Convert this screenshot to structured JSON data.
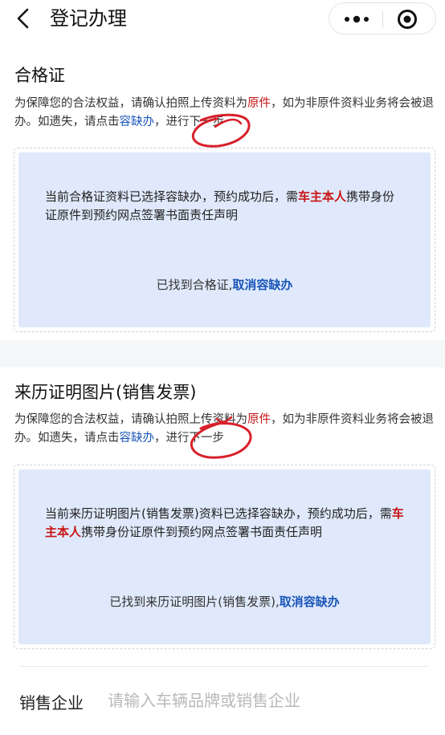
{
  "nav": {
    "title": "登记办理"
  },
  "sections": [
    {
      "title": "合格证",
      "desc_pre": "为保障您的合法权益，请确认拍照上传资料为",
      "desc_red": "原件",
      "desc_mid": "，如为非原件资料业务将会被退办。如遗失，请点击",
      "desc_link": "容缺办",
      "desc_post": "，进行下一步",
      "card_pre": "当前合格证资料已选择容缺办，预约成功后，需",
      "card_red": "车主本人",
      "card_post": "携带身份证原件到预约网点签署书面责任声明",
      "found_text": "已找到合格证,",
      "cancel_link": "取消容缺办"
    },
    {
      "title": "来历证明图片(销售发票)",
      "desc_pre": "为保障您的合法权益，请确认拍照上传资料为",
      "desc_red": "原件",
      "desc_mid": "，如为非原件资料业务将会被退办。如遗失，请点击",
      "desc_link": "容缺办",
      "desc_post": "，进行下一步",
      "card_pre": "当前来历证明图片(销售发票)资料已选择容缺办，预约成功后，需",
      "card_red": "车主本人",
      "card_post": "携带身份证原件到预约网点签署书面责任声明",
      "found_text": "已找到来历证明图片(销售发票),",
      "cancel_link": "取消容缺办"
    }
  ],
  "sales_field": {
    "label": "销售企业",
    "placeholder": "请输入车辆品牌或销售企业",
    "value": ""
  },
  "colors": {
    "red": "#c81414",
    "blue": "#1a55b8",
    "card_bg": "#dfe9fb",
    "annotation": "#d8202a"
  },
  "icons": {
    "back": "chevron-left-icon",
    "more": "more-dots-icon",
    "close": "target-circle-icon"
  }
}
